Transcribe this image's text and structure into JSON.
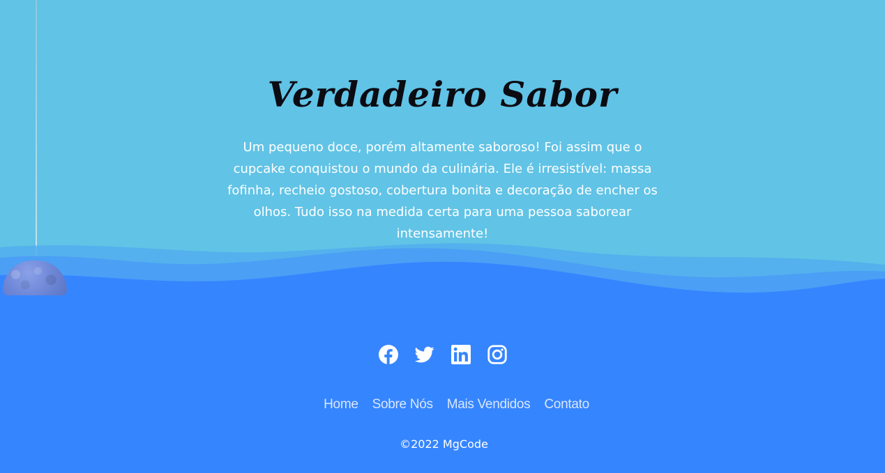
{
  "hero": {
    "title": "Verdadeiro Sabor",
    "description": "Um pequeno doce, porém altamente saboroso! Foi assim que o cupcake conquistou o mundo da culinária. Ele é irresistível: massa fofinha, recheio gostoso, cobertura bonita e decoração de encher os olhos. Tudo isso na medida certa para uma pessoa saborear intensamente!"
  },
  "social": {
    "items": [
      {
        "name": "facebook",
        "icon": "facebook-icon"
      },
      {
        "name": "twitter",
        "icon": "twitter-icon"
      },
      {
        "name": "linkedin",
        "icon": "linkedin-icon"
      },
      {
        "name": "instagram",
        "icon": "instagram-icon"
      }
    ]
  },
  "footer": {
    "nav": [
      "Home",
      "Sobre Nós",
      "Mais Vendidos",
      "Contato"
    ],
    "copyright": "©2022 MgCode"
  },
  "colors": {
    "hero_background": "#61c3e6",
    "footer_background": "#3585ff",
    "title_text": "#0b0b12",
    "nav_text": "#d9e7ff"
  }
}
